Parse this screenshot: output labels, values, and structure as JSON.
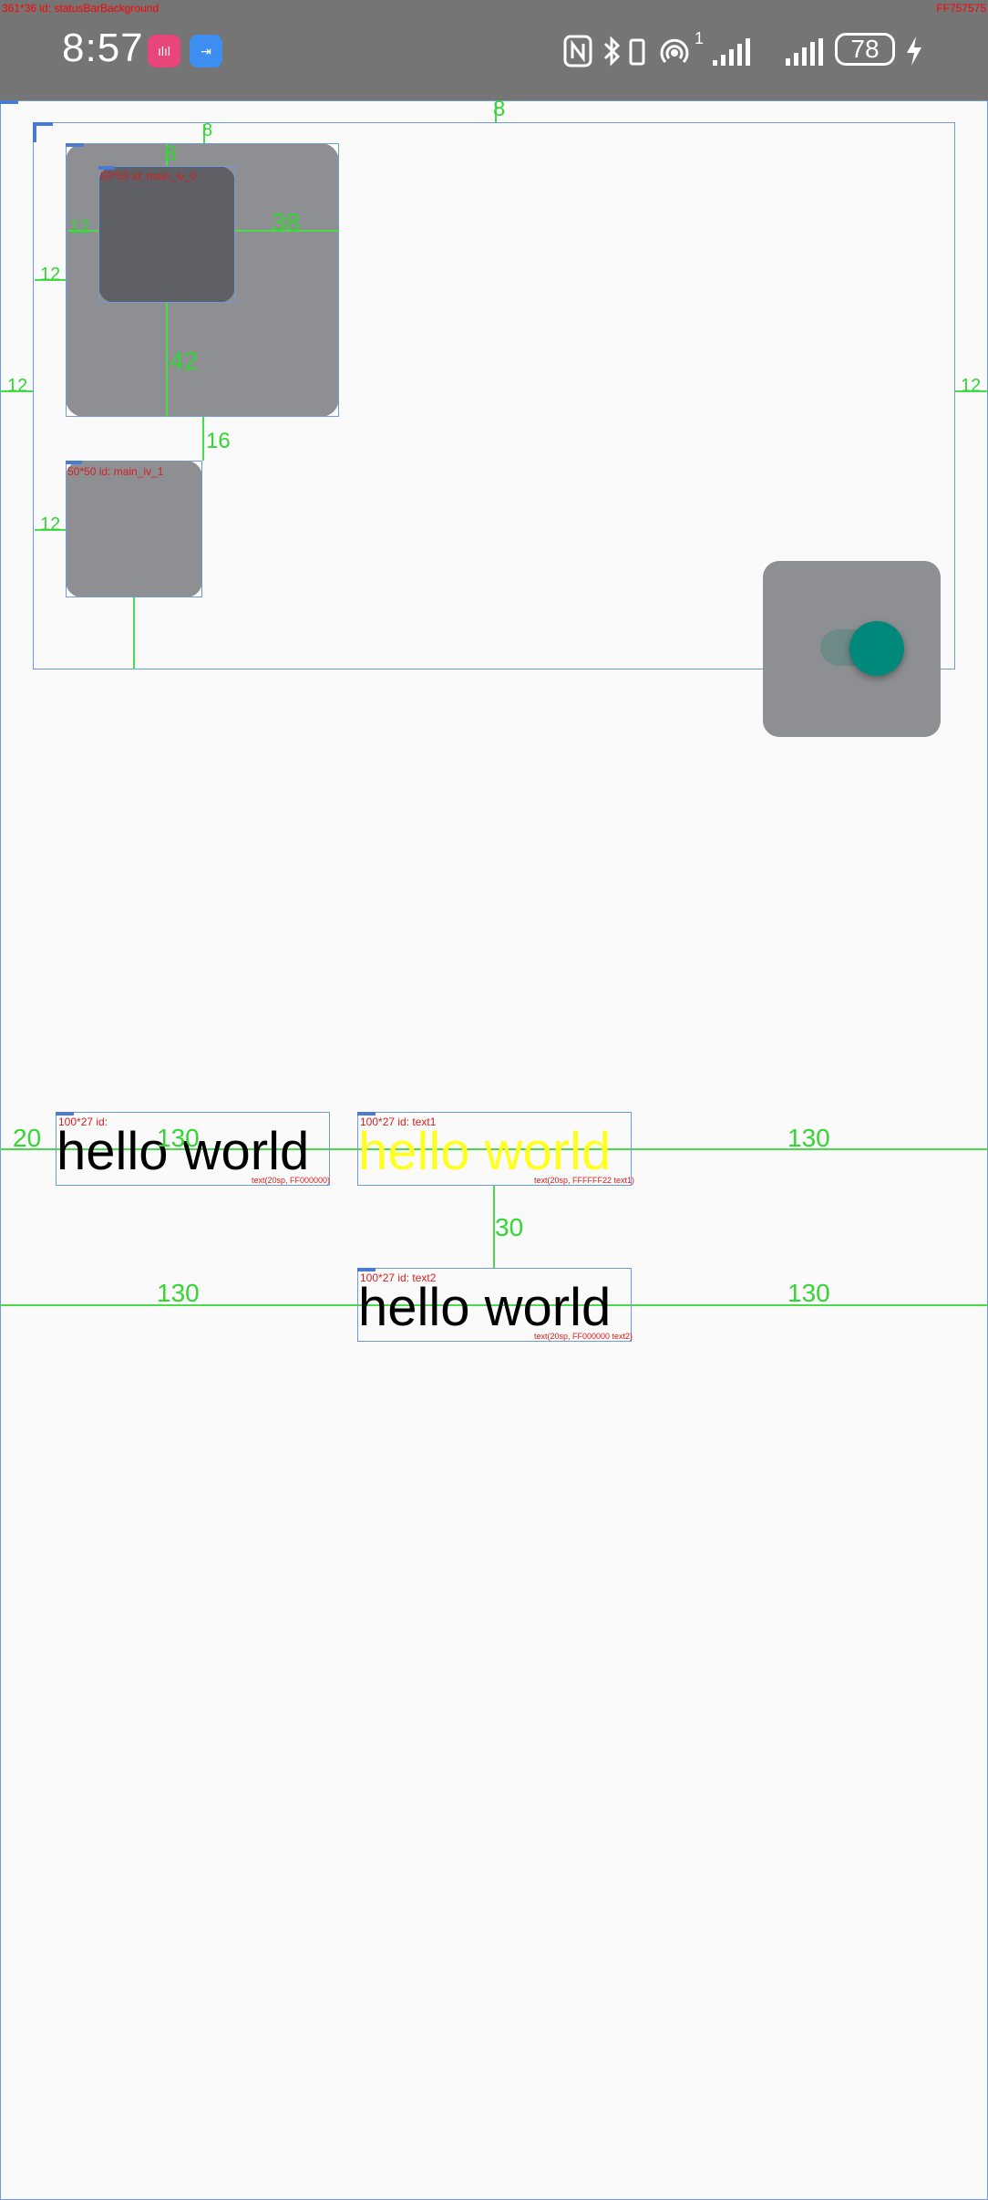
{
  "status_bar": {
    "debug_label": "361*36 id: statusBarBackground",
    "debug_color": "FF757575",
    "time": "8:57",
    "app_badge_1": "ılıl",
    "app_badge_2": "⇥",
    "icons": [
      "nfc-icon",
      "bluetooth-icon",
      "vibrate-icon",
      "hotspot-icon",
      "signal-icon",
      "signal-icon"
    ],
    "hotspot_sup": "1",
    "battery": "78",
    "charging_icon": "bolt-icon"
  },
  "overlay": {
    "top_gap": "8",
    "left_margin": "12",
    "right_margin": "12",
    "outer_left": "12",
    "inner_top": "8",
    "inner_left": "12",
    "inner_right": "38",
    "inner_bottom": "42",
    "inner_debug": "50*50 id: main_iv_0",
    "gap_between": "16",
    "lower_left": "12",
    "lower_debug": "50*50 id: main_iv_1"
  },
  "texts": {
    "t0": {
      "debug": "100*27 id:",
      "text": "hello world",
      "style": "text(20sp, FF000000)",
      "left_margin": "20",
      "right_margin": "130",
      "color": "#000000"
    },
    "t1": {
      "debug": "100*27 id: text1",
      "text": "hello world",
      "style": "text(20sp, FFFFFF22 text1)",
      "right_margin": "130",
      "color": "#ffff22"
    },
    "gap": "30",
    "t2": {
      "debug": "100*27 id: text2",
      "text": "hello world",
      "style": "text(20sp, FF000000 text2)",
      "left_margin": "130",
      "right_margin": "130",
      "color": "#000000"
    }
  },
  "colors": {
    "tile": "#8e8f93",
    "inner_tile": "#5f6065",
    "switch_thumb": "#00897b",
    "guide": "#4cd94c",
    "bounds": "#6f9bd9"
  }
}
